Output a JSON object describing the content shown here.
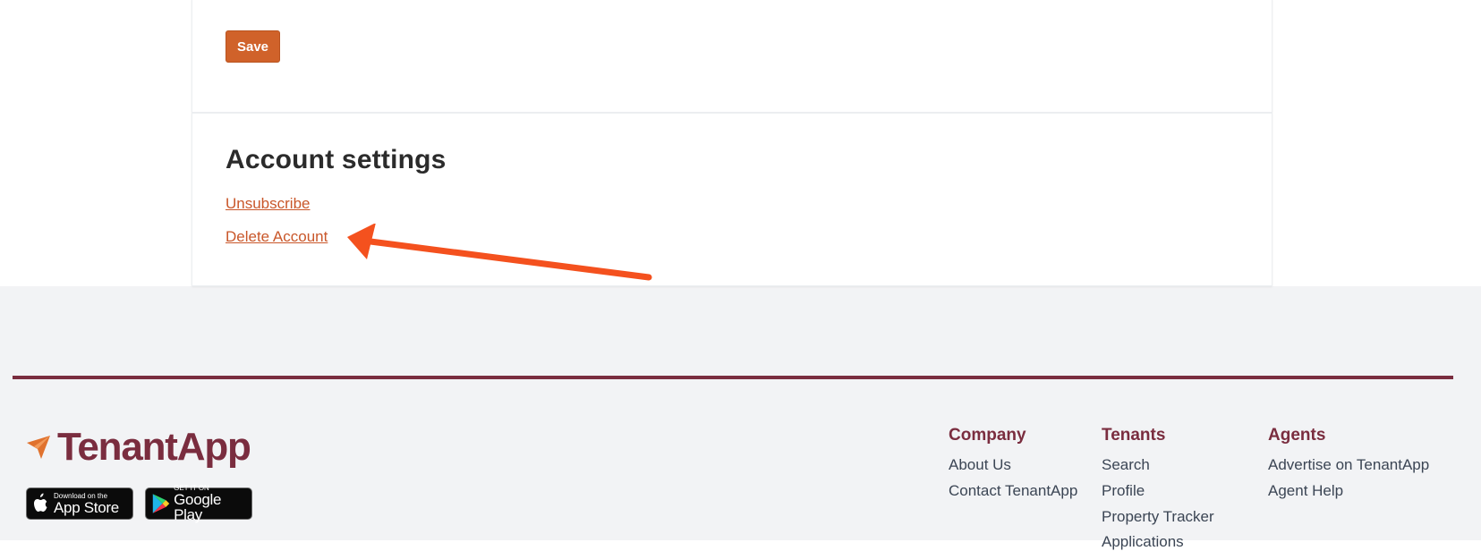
{
  "profile_form": {
    "save_label": "Save"
  },
  "account_settings": {
    "title": "Account settings",
    "unsubscribe_label": "Unsubscribe",
    "delete_account_label": "Delete Account"
  },
  "annotation": {
    "arrow_color": "#f4511e"
  },
  "footer": {
    "brand_name": "TenantApp",
    "brand_color": "#7a2d3f",
    "app_store": {
      "small": "Download on the",
      "big": "App Store"
    },
    "google_play": {
      "small": "GET IT ON",
      "big": "Google Play"
    },
    "columns": {
      "company": {
        "heading": "Company",
        "links": [
          "About Us",
          "Contact TenantApp"
        ]
      },
      "tenants": {
        "heading": "Tenants",
        "links": [
          "Search",
          "Profile",
          "Property Tracker",
          "Applications"
        ]
      },
      "agents": {
        "heading": "Agents",
        "links": [
          "Advertise on TenantApp",
          "Agent Help"
        ]
      }
    }
  }
}
